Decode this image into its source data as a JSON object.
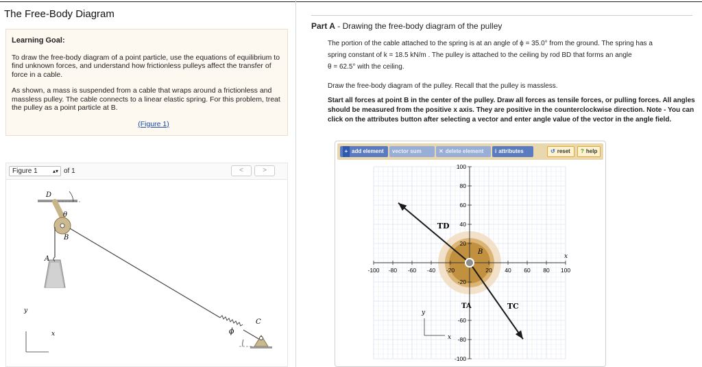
{
  "page": {
    "title": "The Free-Body Diagram"
  },
  "goal": {
    "heading": "Learning Goal:",
    "p1": "To draw the free-body diagram of a point particle, use the equations of equilibrium to find unknown forces, and understand how frictionless pulleys affect the transfer of force in a cable.",
    "p2": "As shown, a mass is suspended from a cable that wraps around a frictionless and massless pulley. The cable connects to a linear elastic spring. For this problem, treat the pulley as a point particle at B.",
    "figure_link": "(Figure 1)"
  },
  "figure": {
    "selector_value": "Figure 1",
    "of_label": "of 1",
    "prev": "<",
    "next": ">",
    "labels": {
      "D": "D",
      "theta": "θ",
      "B": "B",
      "A": "A",
      "phi": "ϕ",
      "C": "C",
      "y": "y",
      "x": "x"
    }
  },
  "part": {
    "prefix": "Part A",
    "title": " - Drawing the free-body diagram of the pulley",
    "line1": "The portion of the cable attached to the spring is at an angle of ϕ = 35.0° from the ground. The spring has a",
    "line2": "spring constant of k = 18.5 kN/m . The pulley is attached to the ceiling by rod BD that forms an angle",
    "line3": "θ = 62.5° with the ceiling.",
    "instruction1": "Draw the free-body diagram of the pulley. Recall that the pulley is massless.",
    "instruction2": "Start all forces at point B in the center of the pulley. Draw all forces as tensile forces, or pulling forces. All angles should be measured from the positive x axis. They are positive in the counterclockwise direction. Note - You can click on the attributes button after selecting a vector and enter angle value of the vector in the angle field."
  },
  "toolbar": {
    "add": "add element",
    "vector_sum": "vector sum",
    "delete": "delete element",
    "attributes": "attributes",
    "reset": "reset",
    "help": "help"
  },
  "canvas": {
    "x_ticks": [
      "-100",
      "-80",
      "-60",
      "-40",
      "-20",
      "20",
      "40",
      "60",
      "80",
      "100"
    ],
    "y_ticks_pos": [
      "100",
      "80",
      "60",
      "40",
      "20"
    ],
    "y_ticks_neg": [
      "-20",
      "-60",
      "-80",
      "-100"
    ],
    "point_label": "B",
    "axis_x": "x",
    "axis_y": "y",
    "vectors": [
      {
        "name": "T_D",
        "label": "TD",
        "angle_deg": 140
      },
      {
        "name": "T_C",
        "label": "TC",
        "angle_deg": -55
      }
    ],
    "t_a_label": "TA"
  },
  "colors": {
    "vector": "#1a1a1a",
    "pulley_outer": "#f1dcc0",
    "pulley_mid": "#d9b06c",
    "pulley_inner": "#b8862d"
  }
}
